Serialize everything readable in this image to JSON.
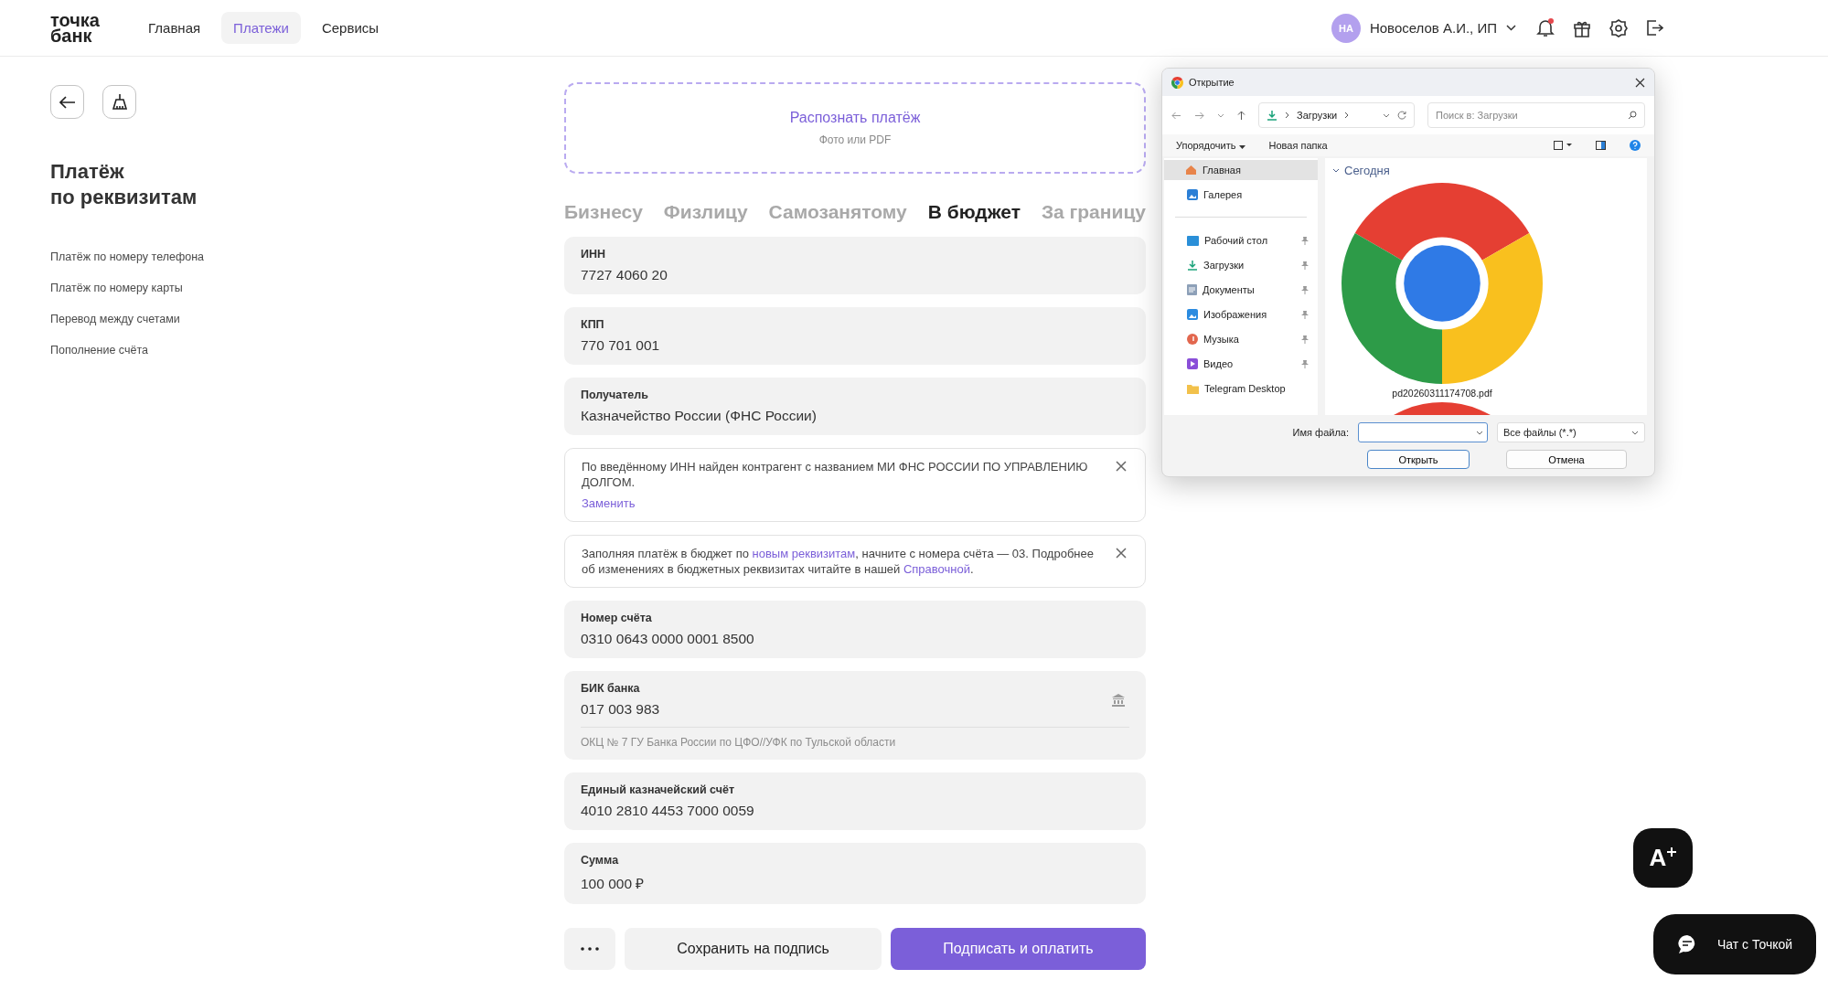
{
  "header": {
    "logo_lines": [
      "точка",
      "банк"
    ],
    "nav": [
      {
        "label": "Главная",
        "selected": false
      },
      {
        "label": "Платежи",
        "selected": true
      },
      {
        "label": "Сервисы",
        "selected": false
      }
    ],
    "user": {
      "initials": "НА",
      "name": "Новоселов А.И., ИП"
    },
    "notifications": {
      "unread": true
    }
  },
  "sidebar": {
    "title_lines": [
      "Платёж",
      "по реквизитам"
    ],
    "links": [
      "Платёж по номеру телефона",
      "Платёж по номеру карты",
      "Перевод между счетами",
      "Пополнение счёта"
    ]
  },
  "recognize": {
    "title": "Распознать платёж",
    "subtitle": "Фото или PDF"
  },
  "recipient_tabs": [
    {
      "label": "Бизнесу",
      "selected": false
    },
    {
      "label": "Физлицу",
      "selected": false
    },
    {
      "label": "Самозанятому",
      "selected": false
    },
    {
      "label": "В бюджет",
      "selected": true
    },
    {
      "label": "За границу",
      "selected": false
    }
  ],
  "form": [
    {
      "kind": "field",
      "label": "ИНН",
      "value": "7727 4060 20"
    },
    {
      "kind": "field",
      "label": "КПП",
      "value": "770 701 001"
    },
    {
      "kind": "field",
      "label": "Получатель",
      "value": "Казначейство России (ФНС России)"
    },
    {
      "kind": "notice",
      "dismissible": true,
      "parts": [
        {
          "text": "По введённому ИНН найден контрагент с названием МИ ФНС РОССИИ ПО УПРАВЛЕНИЮ ДОЛГОМ.",
          "link": false
        }
      ],
      "action": "Заменить"
    },
    {
      "kind": "notice",
      "dismissible": true,
      "parts": [
        {
          "text": "Заполняя платёж в бюджет по ",
          "link": false
        },
        {
          "text": "новым реквизитам",
          "link": true
        },
        {
          "text": ", начните с номера счёта — 03. Подробнее об изменениях в бюджетных реквизитах читайте в нашей ",
          "link": false
        },
        {
          "text": "Справочной",
          "link": true
        },
        {
          "text": ".",
          "link": false
        }
      ]
    },
    {
      "kind": "field",
      "label": "Номер счёта",
      "value": "0310 0643 0000 0001 8500"
    },
    {
      "kind": "bank_field",
      "label": "БИК банка",
      "value": "017 003 983",
      "note": "ОКЦ № 7 ГУ Банка России по ЦФО//УФК по Тульской области"
    },
    {
      "kind": "field",
      "label": "Единый казначейский счёт",
      "value": "4010 2810 4453 7000 0059"
    },
    {
      "kind": "field",
      "label": "Сумма",
      "value": "100 000 ₽"
    }
  ],
  "actions": {
    "save": "Сохранить на подпись",
    "pay": "Подписать и оплатить"
  },
  "file_dialog": {
    "title": "Открытие",
    "path": "Загрузки",
    "search_placeholder": "Поиск в: Загрузки",
    "organize": "Упорядочить",
    "new_folder": "Новая папка",
    "nav_top": [
      {
        "kind": "home",
        "label": "Главная",
        "selected": true,
        "pinned": false
      },
      {
        "kind": "gallery",
        "label": "Галерея",
        "selected": false,
        "pinned": false
      }
    ],
    "nav_quick": [
      {
        "kind": "desktop",
        "label": "Рабочий стол",
        "selected": false,
        "pinned": true
      },
      {
        "kind": "downloads",
        "label": "Загрузки",
        "selected": false,
        "pinned": true
      },
      {
        "kind": "documents",
        "label": "Документы",
        "selected": false,
        "pinned": true
      },
      {
        "kind": "pictures",
        "label": "Изображения",
        "selected": false,
        "pinned": true
      },
      {
        "kind": "music",
        "label": "Музыка",
        "selected": false,
        "pinned": true
      },
      {
        "kind": "video",
        "label": "Видео",
        "selected": false,
        "pinned": true
      },
      {
        "kind": "folder",
        "label": "Telegram Desktop",
        "selected": false,
        "pinned": false
      }
    ],
    "group": "Сегодня",
    "files": [
      {
        "kind": "full",
        "name": "pd20260311174708.pdf"
      },
      {
        "kind": "cut"
      }
    ],
    "filename_label": "Имя файла:",
    "filetype": "Все файлы (*.*)",
    "open": "Открыть",
    "cancel": "Отмена"
  },
  "floating": {
    "font_button": "A",
    "chat": "Чат с Точкой"
  }
}
